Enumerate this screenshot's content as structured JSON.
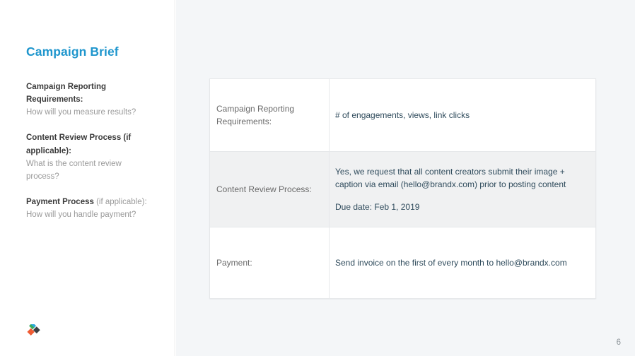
{
  "sidebar": {
    "title": "Campaign Brief",
    "logo_name": "brand-logo",
    "prompts": [
      {
        "question_bold": "Campaign Reporting Requirements:",
        "question_soft": "",
        "answer": "How will you measure results?"
      },
      {
        "question_bold": "Content Review Process (if applicable):",
        "question_soft": "",
        "answer": "What is the content review process?"
      },
      {
        "question_bold": "Payment Process",
        "question_soft": " (if applicable):",
        "answer": "How will you handle payment?"
      }
    ]
  },
  "table": {
    "rows": [
      {
        "label": "Campaign Reporting Requirements:",
        "lines": [
          "# of engagements, views, link clicks"
        ]
      },
      {
        "label": "Content Review Process:",
        "lines": [
          "Yes, we request that all content creators submit their image + caption via email (hello@brandx.com) prior to posting content",
          "Due date: Feb 1, 2019"
        ]
      },
      {
        "label": "Payment:",
        "lines": [
          "Send invoice on the first of every month to hello@brandx.com"
        ]
      }
    ]
  },
  "footer": {
    "page_number": "6"
  },
  "colors": {
    "title_blue": "#1f96cd",
    "value_text": "#2f4b5c",
    "label_text": "#6a6a6a",
    "muted_text": "#9a9a9a",
    "content_bg": "#f4f6f8",
    "alt_row_bg": "#f0f1f2"
  }
}
